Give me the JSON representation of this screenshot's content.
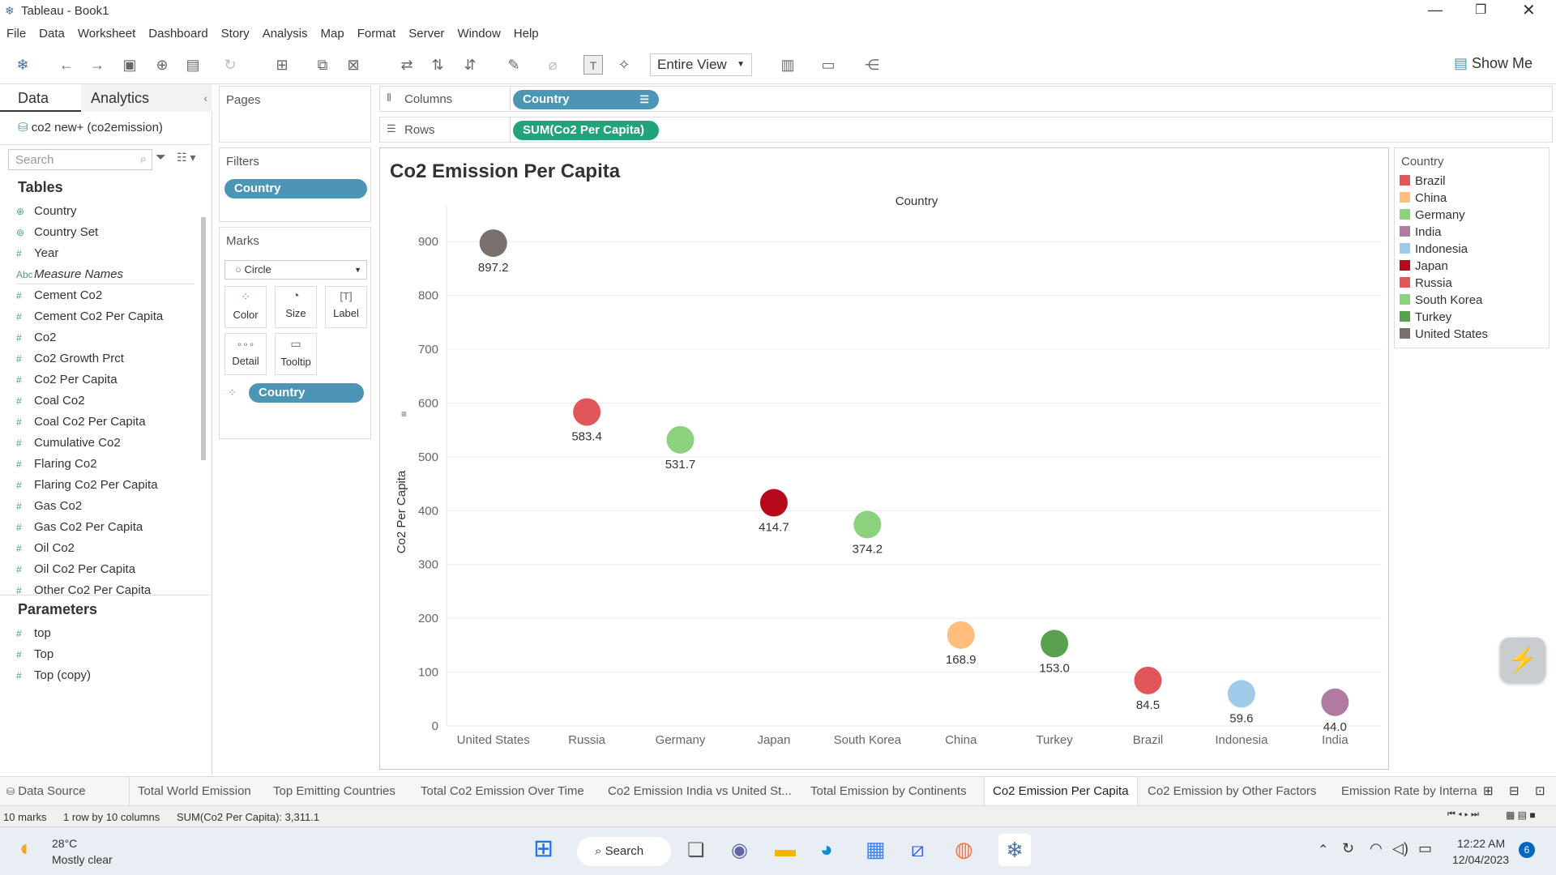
{
  "window": {
    "title": "Tableau - Book1"
  },
  "menu": [
    "File",
    "Data",
    "Worksheet",
    "Dashboard",
    "Story",
    "Analysis",
    "Map",
    "Format",
    "Server",
    "Window",
    "Help"
  ],
  "toolbar": {
    "fit_label": "Entire View",
    "show_me_label": "Show Me"
  },
  "data_pane": {
    "tab_data": "Data",
    "tab_analytics": "Analytics",
    "datasource": "co2 new+ (co2emission)",
    "search_placeholder": "Search",
    "tables_heading": "Tables",
    "fields": [
      {
        "label": "Country",
        "icon": "globe-icon"
      },
      {
        "label": "Country Set",
        "icon": "set-icon"
      },
      {
        "label": "Year",
        "icon": "hash-icon"
      },
      {
        "label": "Measure Names",
        "icon": "abc-icon"
      },
      {
        "label": "Cement Co2",
        "icon": "hash-icon"
      },
      {
        "label": "Cement Co2 Per Capita",
        "icon": "hash-icon"
      },
      {
        "label": "Co2",
        "icon": "hash-icon"
      },
      {
        "label": "Co2 Growth Prct",
        "icon": "hash-icon"
      },
      {
        "label": "Co2 Per Capita",
        "icon": "hash-icon"
      },
      {
        "label": "Coal Co2",
        "icon": "hash-icon"
      },
      {
        "label": "Coal Co2 Per Capita",
        "icon": "hash-icon"
      },
      {
        "label": "Cumulative Co2",
        "icon": "hash-icon"
      },
      {
        "label": "Flaring Co2",
        "icon": "hash-icon"
      },
      {
        "label": "Flaring Co2 Per Capita",
        "icon": "hash-icon"
      },
      {
        "label": "Gas Co2",
        "icon": "hash-icon"
      },
      {
        "label": "Gas Co2 Per Capita",
        "icon": "hash-icon"
      },
      {
        "label": "Oil Co2",
        "icon": "hash-icon"
      },
      {
        "label": "Oil Co2 Per Capita",
        "icon": "hash-icon"
      },
      {
        "label": "Other Co2 Per Capita",
        "icon": "hash-icon"
      }
    ],
    "parameters_heading": "Parameters",
    "parameters": [
      "top",
      "Top",
      "Top (copy)"
    ]
  },
  "pages_card": {
    "title": "Pages"
  },
  "filters_card": {
    "title": "Filters",
    "pill": "Country"
  },
  "marks_card": {
    "title": "Marks",
    "mark_type": "Circle",
    "buttons": [
      "Color",
      "Size",
      "Label",
      "Detail",
      "Tooltip"
    ],
    "color_pill": "Country"
  },
  "shelves": {
    "columns_label": "Columns",
    "columns_pill": "Country",
    "rows_label": "Rows",
    "rows_pill": "SUM(Co2 Per Capita)"
  },
  "legend": {
    "title": "Country",
    "items": [
      {
        "label": "Brazil",
        "color": "#e15759"
      },
      {
        "label": "China",
        "color": "#ffbe7d"
      },
      {
        "label": "Germany",
        "color": "#8cd17d"
      },
      {
        "label": "India",
        "color": "#b07aa1"
      },
      {
        "label": "Indonesia",
        "color": "#a0cbe8"
      },
      {
        "label": "Japan",
        "color": "#b6091c"
      },
      {
        "label": "Russia",
        "color": "#e15759"
      },
      {
        "label": "South Korea",
        "color": "#8cd17d"
      },
      {
        "label": "Turkey",
        "color": "#59a14f"
      },
      {
        "label": "United States",
        "color": "#79706e"
      }
    ]
  },
  "chart_data": {
    "type": "scatter",
    "title": "Co2 Emission Per Capita",
    "xlabel": "Country",
    "ylabel": "Co2 Per Capita",
    "categories": [
      "United States",
      "Russia",
      "Germany",
      "Japan",
      "South Korea",
      "China",
      "Turkey",
      "Brazil",
      "Indonesia",
      "India"
    ],
    "values": [
      897.2,
      583.4,
      531.7,
      414.7,
      374.2,
      168.9,
      153.0,
      84.5,
      59.6,
      44.0
    ],
    "value_labels": [
      "897.2",
      "583.4",
      "531.7",
      "414.7",
      "374.2",
      "168.9",
      "153.0",
      "84.5",
      "59.6",
      "44.0"
    ],
    "colors": [
      "#79706e",
      "#e15759",
      "#8cd17d",
      "#b6091c",
      "#8cd17d",
      "#ffbe7d",
      "#59a14f",
      "#e15759",
      "#a0cbe8",
      "#b07aa1"
    ],
    "yticks": [
      0,
      100,
      200,
      300,
      400,
      500,
      600,
      700,
      800,
      900
    ],
    "ylim": [
      0,
      950
    ],
    "grid": true
  },
  "sheet_tabs": {
    "data_source": "Data Source",
    "tabs": [
      "Total World Emission",
      "Top Emitting Countries",
      "Total Co2 Emission Over Time",
      "Co2 Emission India vs United St...",
      "Total Emission by Continents",
      "Co2 Emission Per Capita",
      "Co2 Emission  by Other Factors",
      "Emission Rate by Interna"
    ],
    "active": "Co2 Emission Per Capita"
  },
  "status": {
    "marks": "10 marks",
    "layout": "1 row by 10 columns",
    "sum": "SUM(Co2 Per Capita): 3,311.1"
  },
  "taskbar": {
    "temp": "28°C",
    "weather": "Mostly clear",
    "search": "Search",
    "time": "12:22 AM",
    "date": "12/04/2023",
    "badge": "6"
  }
}
